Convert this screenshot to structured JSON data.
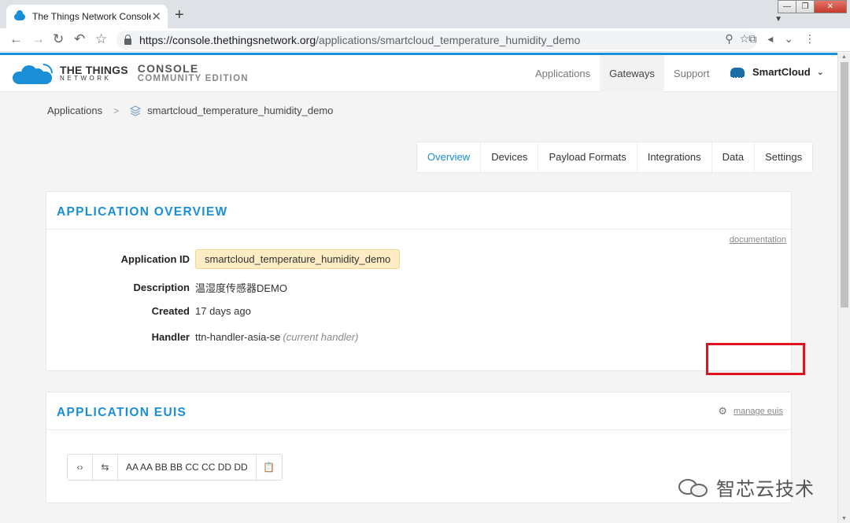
{
  "browser": {
    "tab_title": "The Things Network Console",
    "url_host": "https://console.thethingsnetwork.org",
    "url_path": "/applications/smartcloud_temperature_humidity_demo"
  },
  "header": {
    "logo_line1": "THE THINGS",
    "logo_line2": "NETWORK",
    "console_line1": "CONSOLE",
    "console_line2": "COMMUNITY EDITION",
    "nav": [
      "Applications",
      "Gateways",
      "Support"
    ],
    "active_nav": "Gateways",
    "user": "SmartCloud"
  },
  "breadcrumb": {
    "root": "Applications",
    "current": "smartcloud_temperature_humidity_demo"
  },
  "subtabs": [
    "Overview",
    "Devices",
    "Payload Formats",
    "Integrations",
    "Data",
    "Settings"
  ],
  "active_subtab": "Overview",
  "overview": {
    "title": "APPLICATION OVERVIEW",
    "doc_link": "documentation",
    "fields": {
      "app_id_label": "Application ID",
      "app_id": "smartcloud_temperature_humidity_demo",
      "description_label": "Description",
      "description": "温湿度传感器DEMO",
      "created_label": "Created",
      "created": "17 days ago",
      "handler_label": "Handler",
      "handler": "ttn-handler-asia-se",
      "handler_note": "(current handler)"
    }
  },
  "euis": {
    "title": "APPLICATION EUIS",
    "manage_link": "manage euis",
    "eui_value": "AA AA BB BB CC CC DD DD"
  },
  "watermark": "智芯云技术",
  "colors": {
    "accent": "#1a8fd7",
    "badge_bg": "#fdecc4",
    "badge_text": "#d9962c",
    "highlight_box": "#e0131f"
  }
}
